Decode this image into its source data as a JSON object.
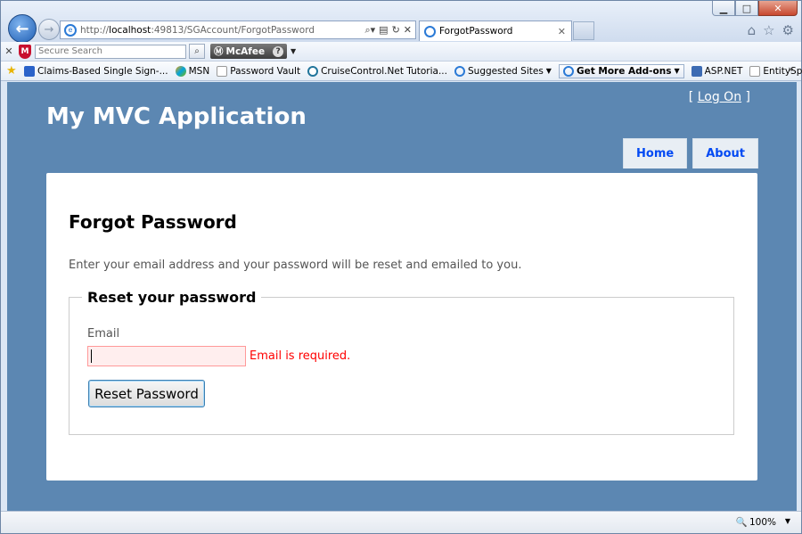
{
  "browser": {
    "address_prefix": "http://",
    "address_host": "localhost",
    "address_rest": ":49813/SGAccount/ForgotPassword",
    "tab_title": "ForgotPassword",
    "search_placeholder": "Secure Search",
    "mcafee_label": "McAfee",
    "favorites": [
      {
        "label": "Claims-Based Single Sign-..."
      },
      {
        "label": "MSN"
      },
      {
        "label": "Password Vault"
      },
      {
        "label": "CruiseControl.Net Tutoria..."
      },
      {
        "label": "Suggested Sites"
      },
      {
        "label": "Get More Add-ons"
      },
      {
        "label": "ASP.NET"
      },
      {
        "label": "EntitySpaces"
      }
    ],
    "zoom": "100%"
  },
  "site": {
    "title": "My MVC Application",
    "logon_open": "[ ",
    "logon_label": "Log On",
    "logon_close": " ]",
    "menu": [
      {
        "label": "Home"
      },
      {
        "label": "About"
      }
    ]
  },
  "content": {
    "heading": "Forgot Password",
    "intro": "Enter your email address and your password will be reset and emailed to you.",
    "legend": "Reset your password",
    "email_label": "Email",
    "email_value": "",
    "email_error": "Email is required.",
    "submit_label": "Reset Password"
  }
}
